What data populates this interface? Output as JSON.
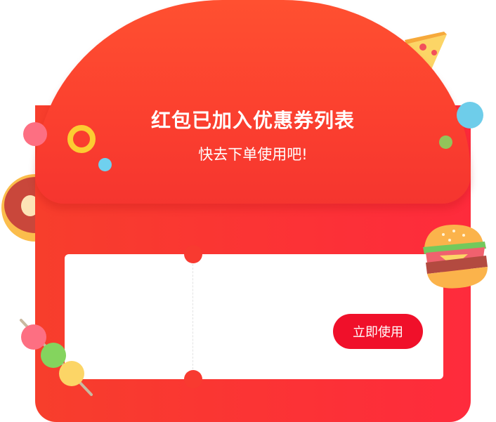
{
  "flap": {
    "title": "红包已加入优惠券列表",
    "subtitle": "快去下单使用吧!"
  },
  "coupon": {
    "use_button_label": "立即使用"
  },
  "colors": {
    "primary_red": "#fb3434",
    "button_red": "#f0102a",
    "coupon_bg": "#ffffff"
  },
  "icons": {
    "food": [
      "pizza-icon",
      "donut-icon",
      "burger-icon",
      "skewer-icon"
    ],
    "confetti": [
      "ring-confetti-icon",
      "dot-confetti-icon"
    ]
  }
}
